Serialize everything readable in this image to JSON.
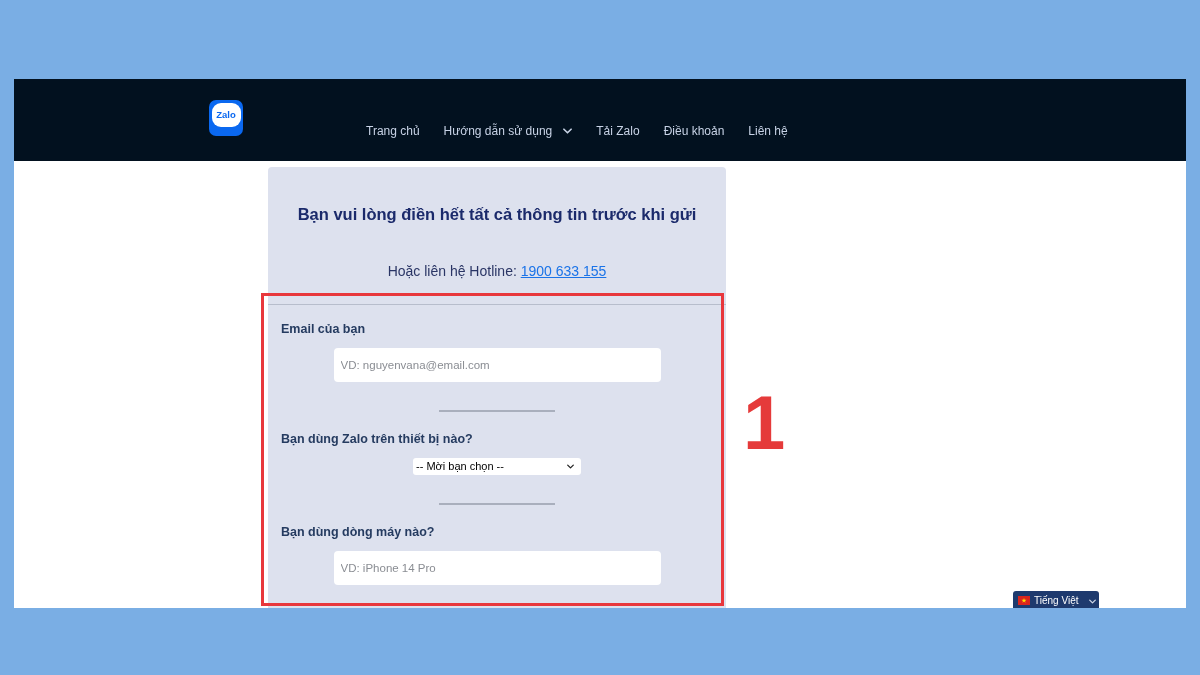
{
  "header": {
    "logo": {
      "text": "Zalo"
    },
    "nav": [
      {
        "label": "Trang chủ",
        "has_dropdown": false
      },
      {
        "label": "Hướng dẫn sử dụng",
        "has_dropdown": true
      },
      {
        "label": "Tải Zalo",
        "has_dropdown": false
      },
      {
        "label": "Điều khoản",
        "has_dropdown": false
      },
      {
        "label": "Liên hệ",
        "has_dropdown": false
      }
    ]
  },
  "form": {
    "title": "Bạn vui lòng điền hết tất cả thông tin trước khi gửi",
    "hotline": {
      "prefix": "Hoặc liên hệ Hotline:",
      "number": "1900 633 155"
    },
    "fields": [
      {
        "kind": "text",
        "label": "Email của bạn",
        "placeholder": "VD: nguyenvana@email.com"
      },
      {
        "kind": "select",
        "label": "Bạn dùng Zalo trên thiết bị nào?",
        "value": "-- Mời bạn chọn --"
      },
      {
        "kind": "text",
        "label": "Bạn dùng dòng máy nào?",
        "placeholder": "VD: iPhone 14 Pro"
      }
    ]
  },
  "language_switcher": {
    "label": "Tiếng Việt"
  },
  "annotation": {
    "label": "1"
  }
}
